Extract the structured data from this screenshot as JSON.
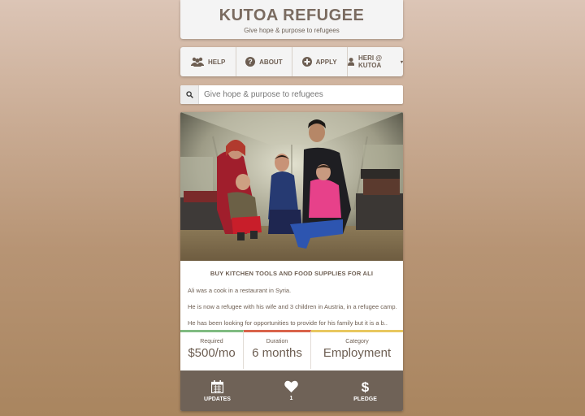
{
  "header": {
    "title": "KUTOA REFUGEE",
    "tagline": "Give hope & purpose to refugees"
  },
  "nav": {
    "items": [
      {
        "label": "HELP",
        "icon": "users-icon"
      },
      {
        "label": "ABOUT",
        "icon": "question-circle-icon"
      },
      {
        "label": "APPLY",
        "icon": "plus-circle-icon"
      },
      {
        "label": "HERI @ KUTOA",
        "icon": "user-icon"
      }
    ]
  },
  "search": {
    "placeholder": "Give hope & purpose to refugees",
    "icon": "search-icon"
  },
  "card": {
    "title": "BUY KITCHEN TOOLS AND FOOD SUPPLIES FOR ALI",
    "paragraphs": [
      "Ali was a cook in a restaurant in Syria.",
      "He is now a refugee with his wife and 3 children in Austria, in a refugee camp.",
      "He has been looking for opportunities to provide for his family but it is a b.."
    ],
    "stats": [
      {
        "label": "Required",
        "value": "$500/mo",
        "color": "#7fbb81"
      },
      {
        "label": "Duration",
        "value": "6 months",
        "color": "#d9634a"
      },
      {
        "label": "Category",
        "value": "Employment",
        "color": "#e8c75f"
      }
    ],
    "actions": [
      {
        "label": "UPDATES",
        "icon": "calendar-icon"
      },
      {
        "label": "1",
        "icon": "heart-icon"
      },
      {
        "label": "PLEDGE",
        "icon": "dollar-icon"
      }
    ]
  },
  "colors": {
    "accent_text": "#6d5e52",
    "action_bar": "#6f6257"
  }
}
